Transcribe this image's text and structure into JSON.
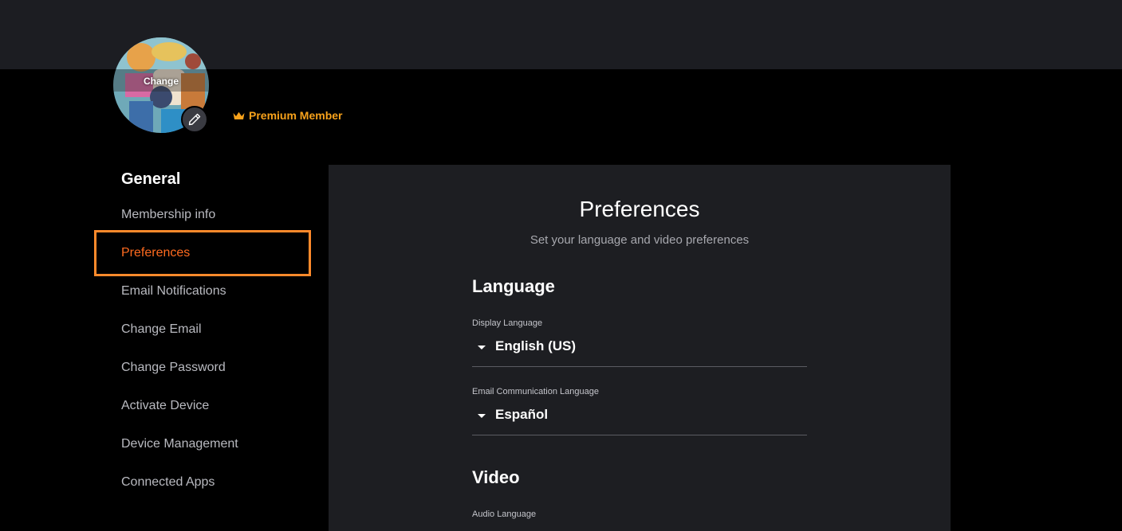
{
  "profile": {
    "change_label": "Change",
    "premium_label": "Premium Member",
    "premium_color": "#f8a21b"
  },
  "sidebar": {
    "heading": "General",
    "items": [
      {
        "label": "Membership info"
      },
      {
        "label": "Preferences"
      },
      {
        "label": "Email Notifications"
      },
      {
        "label": "Change Email"
      },
      {
        "label": "Change Password"
      },
      {
        "label": "Activate Device"
      },
      {
        "label": "Device Management"
      },
      {
        "label": "Connected Apps"
      }
    ],
    "active_color": "#ff6b1f"
  },
  "preferences": {
    "title": "Preferences",
    "subtitle": "Set your language and video preferences",
    "language_section": "Language",
    "display_language_label": "Display Language",
    "display_language_value": "English (US)",
    "email_language_label": "Email Communication Language",
    "email_language_value": "Español",
    "video_section": "Video",
    "audio_language_label": "Audio Language"
  }
}
